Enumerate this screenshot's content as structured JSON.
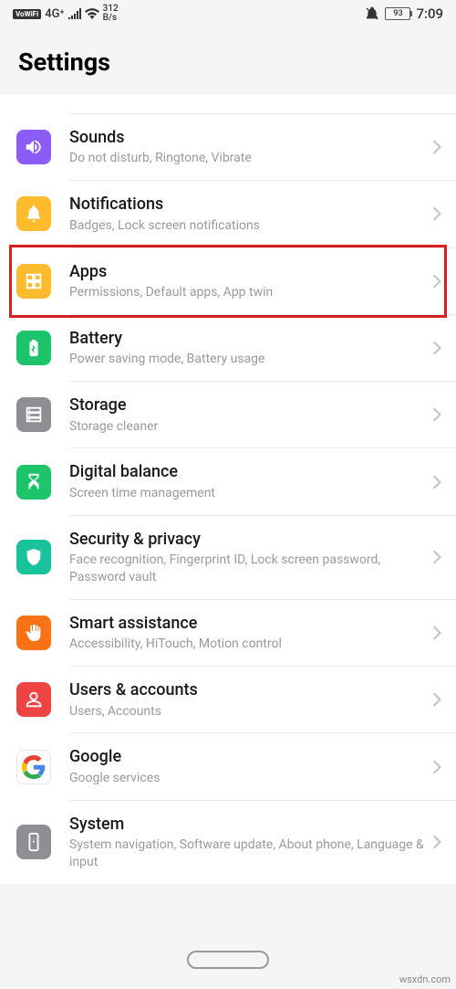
{
  "statusBar": {
    "vowifi": "VoWiFi",
    "network": "4G⁺",
    "speed": "312",
    "speedUnit": "B/s",
    "battery": "93",
    "time": "7:09"
  },
  "header": {
    "title": "Settings"
  },
  "items": [
    {
      "key": "sounds",
      "title": "Sounds",
      "subtitle": "Do not disturb, Ringtone, Vibrate",
      "bg": "bg-purple",
      "icon": "speaker-icon"
    },
    {
      "key": "notifications",
      "title": "Notifications",
      "subtitle": "Badges, Lock screen notifications",
      "bg": "bg-yellow",
      "icon": "bell-icon"
    },
    {
      "key": "apps",
      "title": "Apps",
      "subtitle": "Permissions, Default apps, App twin",
      "bg": "bg-yellow",
      "icon": "apps-icon",
      "highlighted": true
    },
    {
      "key": "battery",
      "title": "Battery",
      "subtitle": "Power saving mode, Battery usage",
      "bg": "bg-green",
      "icon": "battery-icon"
    },
    {
      "key": "storage",
      "title": "Storage",
      "subtitle": "Storage cleaner",
      "bg": "bg-gray",
      "icon": "storage-icon"
    },
    {
      "key": "digital-balance",
      "title": "Digital balance",
      "subtitle": "Screen time management",
      "bg": "bg-green",
      "icon": "hourglass-icon"
    },
    {
      "key": "security",
      "title": "Security & privacy",
      "subtitle": "Face recognition, Fingerprint ID, Lock screen password, Password vault",
      "bg": "bg-teal",
      "icon": "shield-icon"
    },
    {
      "key": "smart-assistance",
      "title": "Smart assistance",
      "subtitle": "Accessibility, HiTouch, Motion control",
      "bg": "bg-orange",
      "icon": "hand-icon"
    },
    {
      "key": "users",
      "title": "Users & accounts",
      "subtitle": "Users, Accounts",
      "bg": "bg-red",
      "icon": "user-icon"
    },
    {
      "key": "google",
      "title": "Google",
      "subtitle": "Google services",
      "bg": "google-tile",
      "icon": "google-icon"
    },
    {
      "key": "system",
      "title": "System",
      "subtitle": "System navigation, Software update, About phone, Language & input",
      "bg": "bg-gray",
      "icon": "system-icon"
    }
  ],
  "watermark": "wsxdn.com"
}
